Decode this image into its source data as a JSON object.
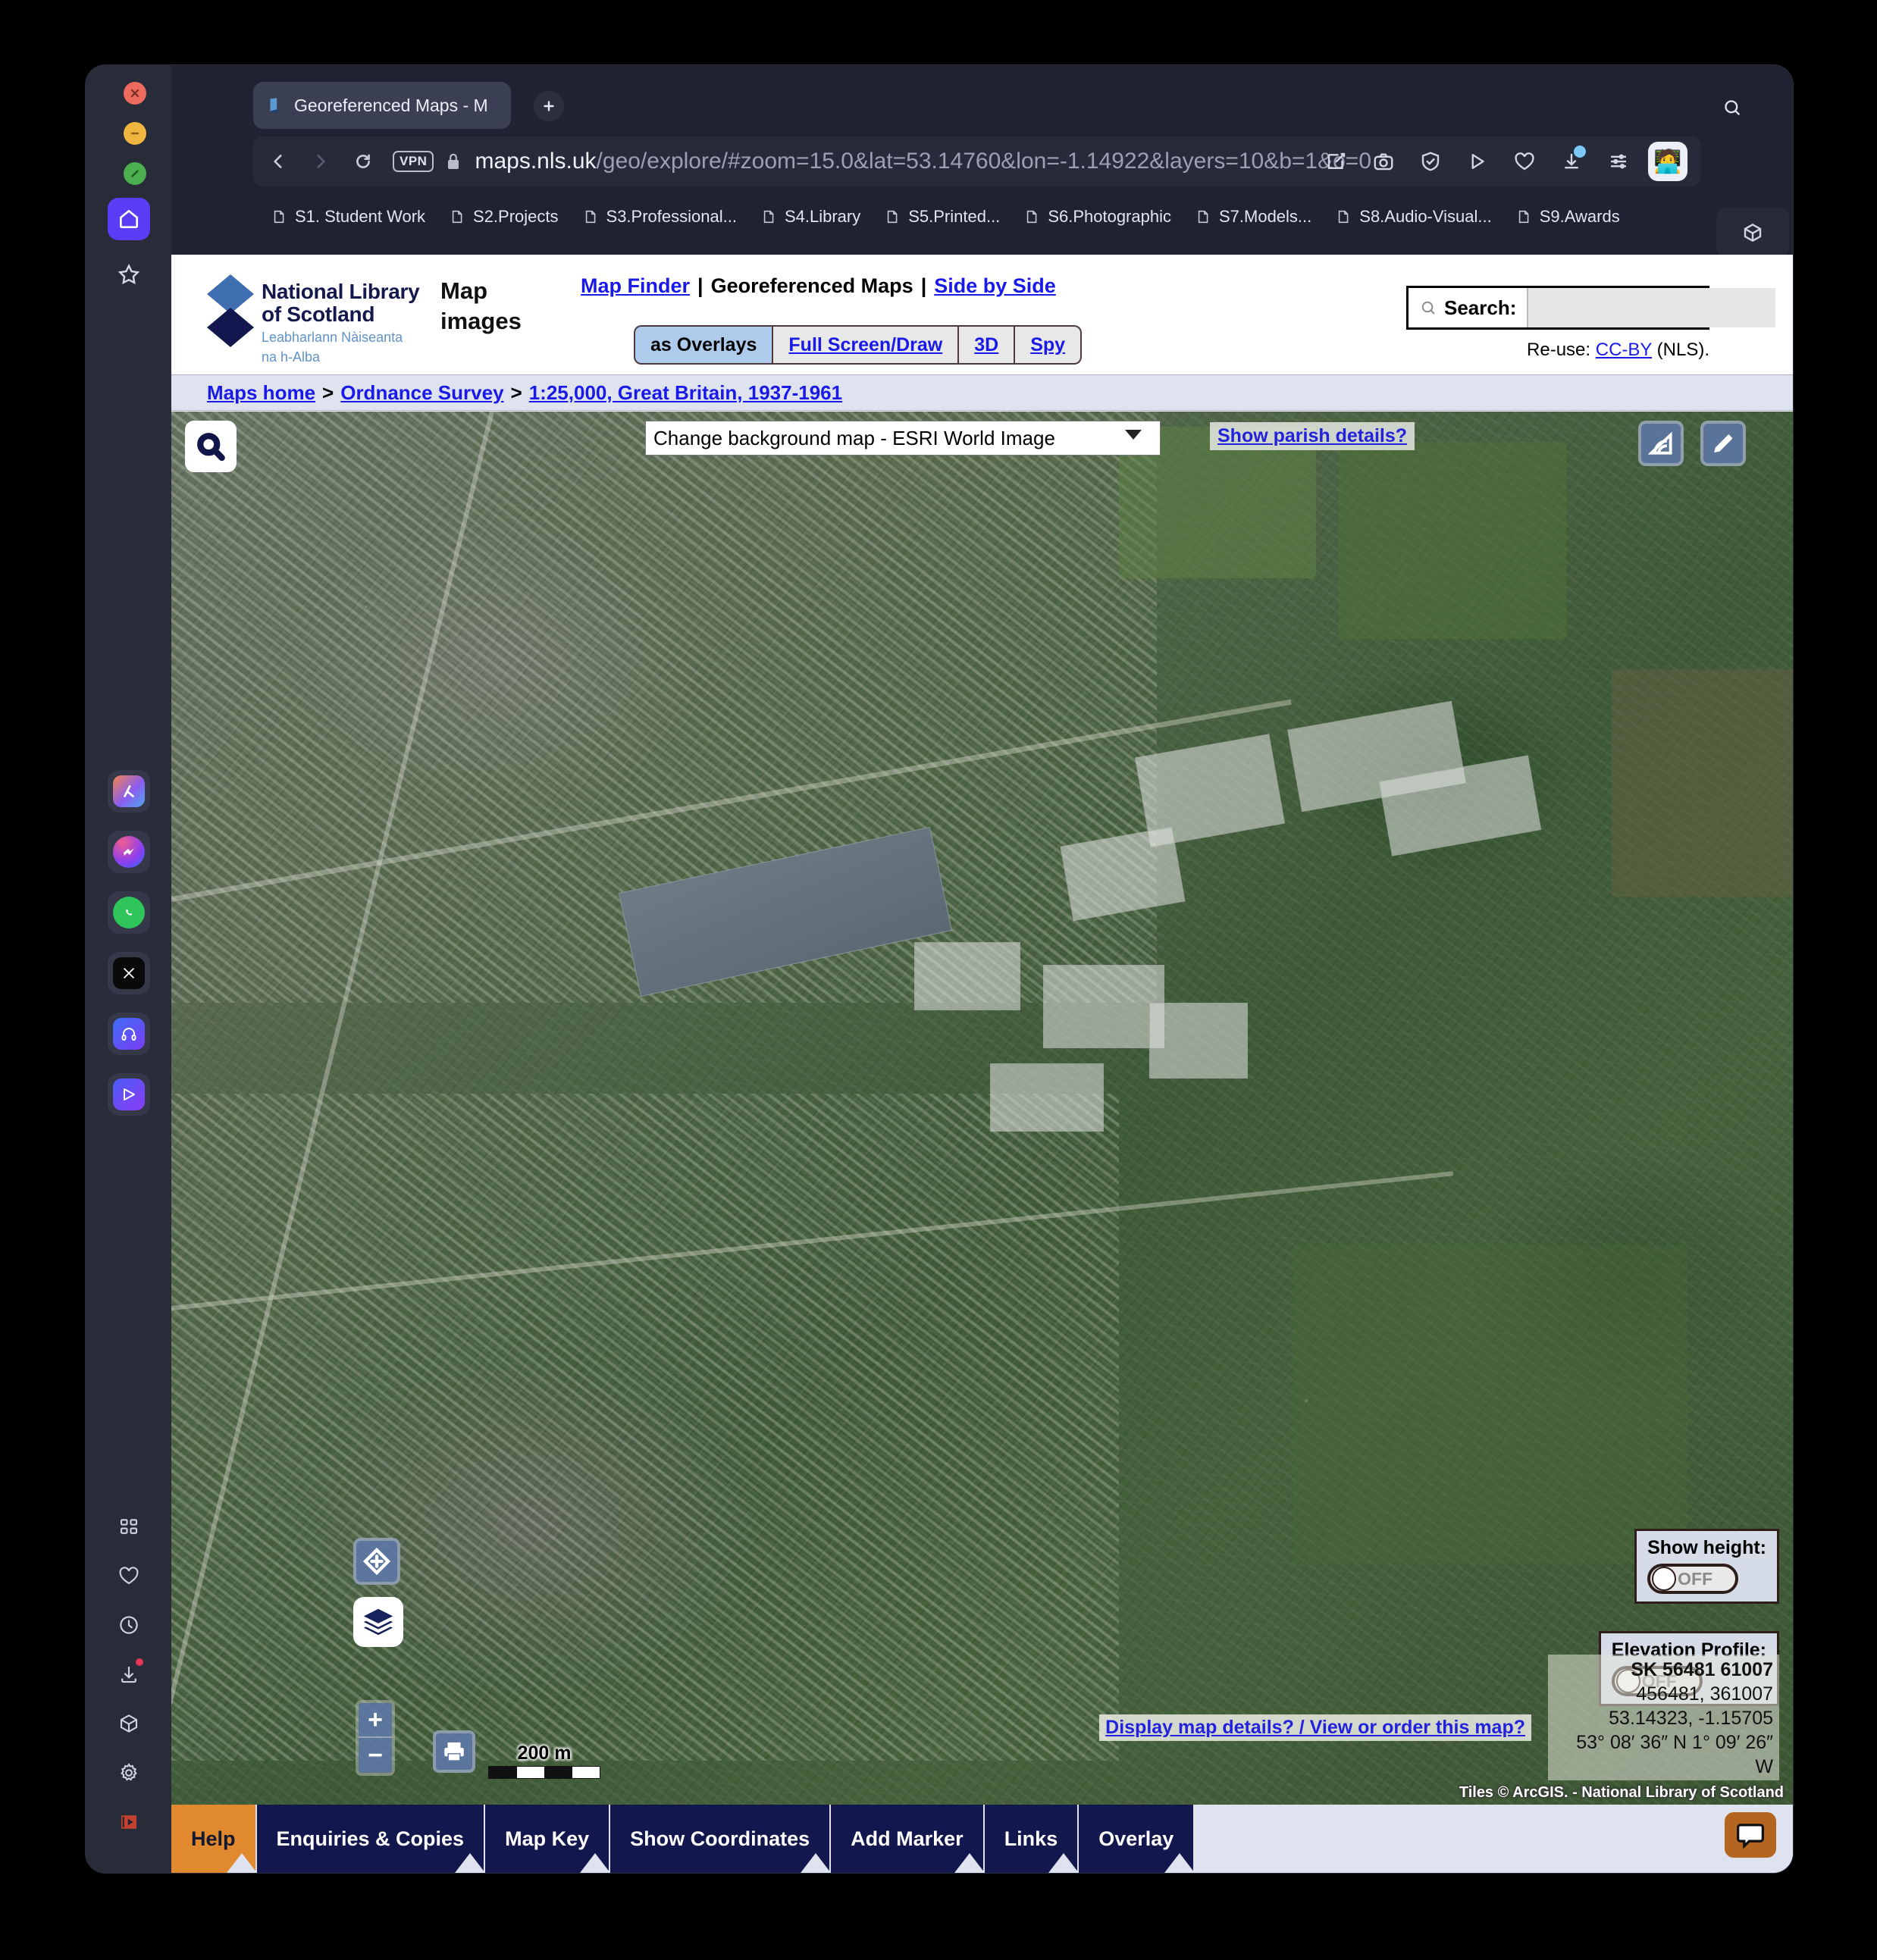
{
  "browser": {
    "tab_title": "Georeferenced Maps - M",
    "tab_favicon": "book-icon",
    "new_tab_label": "+",
    "url_host": "maps.nls.uk",
    "url_path": "/geo/explore/#zoom=15.0&lat=53.14760&lon=-1.14922&layers=10&b=1&o=0",
    "url_full": "maps.nls.uk/geo/explore/#zoom=15.0&lat=53.14760&lon=-1.14922&layers=10&b=1&o=0",
    "vpn_label": "VPN",
    "avatar_emoji": "🧑‍💻",
    "bookmarks": [
      {
        "label": "S1. Student Work"
      },
      {
        "label": "S2.Projects"
      },
      {
        "label": "S3.Professional..."
      },
      {
        "label": "S4.Library"
      },
      {
        "label": "S5.Printed..."
      },
      {
        "label": "S6.Photographic"
      },
      {
        "label": "S7.Models..."
      },
      {
        "label": "S8.Audio-Visual..."
      },
      {
        "label": "S9.Awards"
      }
    ]
  },
  "dock": {
    "apps": [
      "arc-icon",
      "messenger-icon",
      "whatsapp-icon",
      "x-icon",
      "headphones-icon",
      "send-icon"
    ],
    "tools": [
      "grid-icon",
      "heart-icon",
      "history-icon",
      "downloads-icon",
      "cube-icon",
      "gear-icon",
      "video-icon",
      "more-icon"
    ]
  },
  "site": {
    "logo_line1": "National Library",
    "logo_line2": "of Scotland",
    "logo_gaelic1": "Leabharlann Nàiseanta",
    "logo_gaelic2": "na h-Alba",
    "section_title": "Map images",
    "nav": {
      "map_finder": "Map Finder",
      "georeferenced_maps": "Georeferenced Maps",
      "side_by_side": "Side by Side",
      "separator": "|"
    },
    "modes": [
      {
        "label": "as Overlays",
        "active": true
      },
      {
        "label": "Full Screen/Draw",
        "active": false
      },
      {
        "label": "3D",
        "active": false
      },
      {
        "label": "Spy",
        "active": false
      }
    ],
    "search": {
      "label": "Search:",
      "value": "",
      "placeholder": ""
    },
    "reuse_prefix": "Re-use:",
    "reuse_link": "CC-BY",
    "reuse_suffix": "(NLS).",
    "breadcrumb": [
      {
        "label": "Maps home",
        "link": true
      },
      {
        "label": "Ordnance Survey",
        "link": true
      },
      {
        "label": "1:25,000, Great Britain, 1937-1961",
        "link": true
      }
    ],
    "breadcrumb_sep": ">"
  },
  "map": {
    "background_select": "Change background map - ESRI World Image",
    "background_options": [
      "Change background map - ESRI World Image"
    ],
    "parish_link": "Show parish details?",
    "tools": [
      "search-icon",
      "measure-icon",
      "pencil-icon",
      "geolocate-icon",
      "layers-icon",
      "print-icon"
    ],
    "zoom_in": "+",
    "zoom_out": "−",
    "scale_label": "200 m",
    "show_height": {
      "label": "Show height:",
      "state": "OFF"
    },
    "elevation_profile": {
      "label": "Elevation Profile:",
      "state": "OFF"
    },
    "coordinates": {
      "grid_ref": "SK 56481 61007",
      "eastings_northings": "456481, 361007",
      "decimal": "53.14323, -1.15705",
      "dms": "53° 08′ 36″ N 1° 09′ 26″ W"
    },
    "display_link": "Display map details? / View or order this map?",
    "attribution": "Tiles © ArcGIS. - National Library of Scotland"
  },
  "bottom_toolbar": {
    "tabs": [
      {
        "label": "Help",
        "highlight": true
      },
      {
        "label": "Enquiries & Copies",
        "highlight": false
      },
      {
        "label": "Map Key",
        "highlight": false
      },
      {
        "label": "Show Coordinates",
        "highlight": false
      },
      {
        "label": "Add Marker",
        "highlight": false
      },
      {
        "label": "Links",
        "highlight": false
      },
      {
        "label": "Overlay",
        "highlight": false
      }
    ],
    "chat_button": "chat-bubble-icon"
  },
  "colors": {
    "accent_blue": "#1a1ae8",
    "nav_dark": "#12174d",
    "help_orange": "#e0892f",
    "active_mode": "#aecbec",
    "breadcrumb_bg": "#dfe2ef"
  }
}
